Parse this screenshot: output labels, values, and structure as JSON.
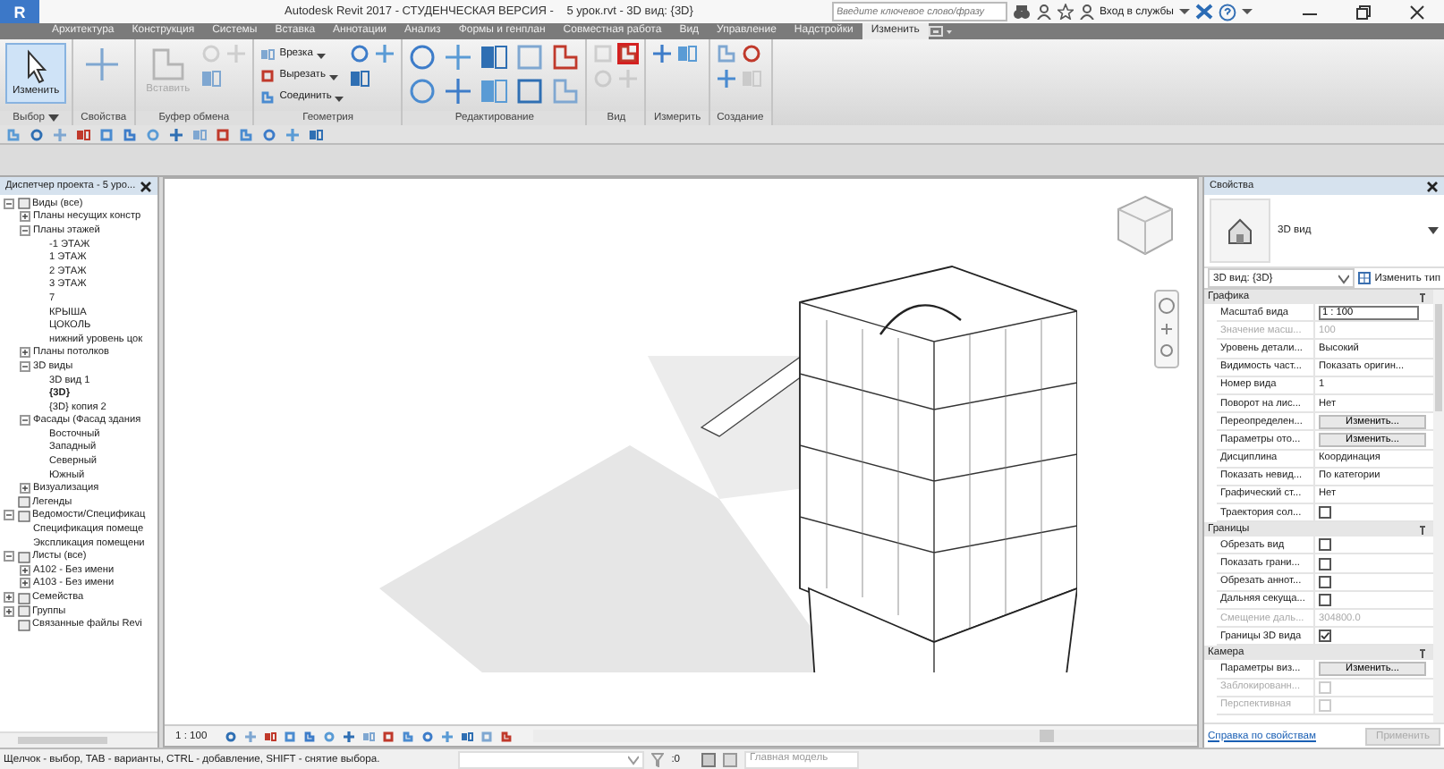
{
  "window": {
    "app_logo": "R",
    "title": "Autodesk Revit 2017 - СТУДЕНЧЕСКАЯ ВЕРСИЯ -    5 урок.rvt - 3D вид: {3D}",
    "search": {
      "placeholder": "Введите ключевое слово/фразу"
    },
    "sign_in": "Вход в службы"
  },
  "ribbon": {
    "tabs": [
      {
        "label": "Архитектура",
        "selected": false
      },
      {
        "label": "Конструкция",
        "selected": false
      },
      {
        "label": "Системы",
        "selected": false
      },
      {
        "label": "Вставка",
        "selected": false
      },
      {
        "label": "Аннотации",
        "selected": false
      },
      {
        "label": "Анализ",
        "selected": false
      },
      {
        "label": "Формы и генплан",
        "selected": false
      },
      {
        "label": "Совместная работа",
        "selected": false
      },
      {
        "label": "Вид",
        "selected": false
      },
      {
        "label": "Управление",
        "selected": false
      },
      {
        "label": "Надстройки",
        "selected": false
      },
      {
        "label": "Изменить",
        "selected": true
      }
    ],
    "panels": [
      {
        "label": "Выбор",
        "dropdown": true,
        "tools": [
          {
            "kind": "large",
            "label": "Изменить",
            "selected": true,
            "disabled": false,
            "highlighted": false
          }
        ]
      },
      {
        "label": "Свойства",
        "dropdown": false,
        "tools": [
          {
            "kind": "large",
            "selected": false,
            "disabled": false,
            "highlighted": false
          }
        ]
      },
      {
        "label": "Буфер обмена",
        "dropdown": false,
        "tools": [
          {
            "kind": "large",
            "label": "Вставить",
            "selected": false,
            "disabled": true,
            "highlighted": false
          },
          {
            "kind": "icon",
            "selected": false,
            "disabled": true,
            "highlighted": false
          },
          {
            "kind": "icon",
            "selected": false,
            "disabled": true,
            "highlighted": false
          },
          {
            "kind": "icon",
            "selected": false,
            "disabled": false,
            "highlighted": false
          }
        ]
      },
      {
        "label": "Геометрия",
        "dropdown": false,
        "tools": [
          {
            "kind": "small",
            "label": "Врезка",
            "selected": false,
            "disabled": false,
            "highlighted": false
          },
          {
            "kind": "small",
            "label": "Вырезать",
            "selected": false,
            "disabled": false,
            "highlighted": false
          },
          {
            "kind": "small",
            "label": "Соединить",
            "selected": false,
            "disabled": false,
            "highlighted": false
          },
          {
            "kind": "icon",
            "selected": false,
            "disabled": false,
            "highlighted": false
          },
          {
            "kind": "icon",
            "selected": false,
            "disabled": false,
            "highlighted": false
          },
          {
            "kind": "icon",
            "selected": false,
            "disabled": false,
            "highlighted": false
          }
        ]
      },
      {
        "label": "Редактирование",
        "dropdown": false,
        "tools": [
          {
            "kind": "icon",
            "selected": false,
            "disabled": false,
            "highlighted": false
          },
          {
            "kind": "icon",
            "selected": false,
            "disabled": false,
            "highlighted": false
          },
          {
            "kind": "icon",
            "selected": false,
            "disabled": false,
            "highlighted": false
          },
          {
            "kind": "icon",
            "selected": false,
            "disabled": false,
            "highlighted": false
          },
          {
            "kind": "icon",
            "selected": false,
            "disabled": false,
            "highlighted": false
          },
          {
            "kind": "icon",
            "selected": false,
            "disabled": false,
            "highlighted": false
          },
          {
            "kind": "icon",
            "selected": false,
            "disabled": false,
            "highlighted": false
          },
          {
            "kind": "icon",
            "selected": false,
            "disabled": false,
            "highlighted": false
          },
          {
            "kind": "icon",
            "selected": false,
            "disabled": false,
            "highlighted": false
          },
          {
            "kind": "icon",
            "selected": false,
            "disabled": false,
            "highlighted": false
          }
        ]
      },
      {
        "label": "Вид",
        "dropdown": false,
        "tools": [
          {
            "kind": "icon",
            "selected": false,
            "disabled": true,
            "highlighted": false
          },
          {
            "kind": "icon",
            "selected": false,
            "disabled": false,
            "highlighted": true
          },
          {
            "kind": "icon",
            "selected": false,
            "disabled": true,
            "highlighted": false
          },
          {
            "kind": "icon",
            "selected": false,
            "disabled": true,
            "highlighted": false
          }
        ]
      },
      {
        "label": "Измерить",
        "dropdown": false,
        "tools": [
          {
            "kind": "icon",
            "selected": false,
            "disabled": false,
            "highlighted": false
          },
          {
            "kind": "icon",
            "selected": false,
            "disabled": false,
            "highlighted": false
          }
        ]
      },
      {
        "label": "Создание",
        "dropdown": false,
        "tools": [
          {
            "kind": "icon",
            "selected": false,
            "disabled": false,
            "highlighted": false
          },
          {
            "kind": "icon",
            "selected": false,
            "disabled": false,
            "highlighted": false
          },
          {
            "kind": "icon",
            "selected": false,
            "disabled": false,
            "highlighted": false
          },
          {
            "kind": "icon",
            "selected": false,
            "disabled": true,
            "highlighted": false
          }
        ]
      }
    ]
  },
  "project_browser": {
    "title": "Диспетчер проекта - 5 уро...",
    "tree": [
      {
        "label": "Виды (все)",
        "expanded": true,
        "selected": false,
        "children": [
          {
            "label": "Планы несущих констр",
            "expanded": false,
            "selected": false
          },
          {
            "label": "Планы этажей",
            "expanded": true,
            "selected": false,
            "children": [
              {
                "label": "-1 ЭТАЖ",
                "selected": false
              },
              {
                "label": "1 ЭТАЖ",
                "selected": false
              },
              {
                "label": "2 ЭТАЖ",
                "selected": false
              },
              {
                "label": "3 ЭТАЖ",
                "selected": false
              },
              {
                "label": "7",
                "selected": false
              },
              {
                "label": "КРЫША",
                "selected": false
              },
              {
                "label": "ЦОКОЛЬ",
                "selected": false
              },
              {
                "label": "нижний уровень цок",
                "selected": false
              }
            ]
          },
          {
            "label": "Планы потолков",
            "expanded": false,
            "selected": false
          },
          {
            "label": "3D виды",
            "expanded": true,
            "selected": false,
            "children": [
              {
                "label": "3D вид 1",
                "selected": false
              },
              {
                "label": "{3D}",
                "selected": true
              },
              {
                "label": "{3D} копия 2",
                "selected": false
              }
            ]
          },
          {
            "label": "Фасады (Фасад здания",
            "expanded": true,
            "selected": false,
            "children": [
              {
                "label": "Восточный",
                "selected": false
              },
              {
                "label": "Западный",
                "selected": false
              },
              {
                "label": "Северный",
                "selected": false
              },
              {
                "label": "Южный",
                "selected": false
              }
            ]
          },
          {
            "label": "Визуализация",
            "expanded": false,
            "selected": false
          }
        ]
      },
      {
        "label": "Легенды",
        "selected": false
      },
      {
        "label": "Ведомости/Спецификац",
        "expanded": true,
        "selected": false,
        "children": [
          {
            "label": "Спецификация помеще",
            "selected": false
          },
          {
            "label": "Экспликация помещени",
            "selected": false
          }
        ]
      },
      {
        "label": "Листы (все)",
        "expanded": true,
        "selected": false,
        "children": [
          {
            "label": "A102 - Без имени",
            "expanded": false,
            "selected": false
          },
          {
            "label": "A103 - Без имени",
            "expanded": false,
            "selected": false
          }
        ]
      },
      {
        "label": "Семейства",
        "expanded": false,
        "selected": false
      },
      {
        "label": "Группы",
        "expanded": false,
        "selected": false
      },
      {
        "label": "Связанные файлы Revi",
        "selected": false
      }
    ]
  },
  "view": {
    "scale": "1 : 100"
  },
  "properties": {
    "title": "Свойства",
    "type_name": "3D вид",
    "instance": "3D вид: {3D}",
    "edit_type": "Изменить тип",
    "groups": [
      {
        "name": "Графика",
        "rows": [
          {
            "kind": "input",
            "label": "Масштаб вида",
            "value": "1 : 100",
            "disabled": false
          },
          {
            "kind": "text",
            "label": "Значение масш...",
            "value": "100",
            "disabled": true
          },
          {
            "kind": "text",
            "label": "Уровень детали...",
            "value": "Высокий",
            "disabled": false
          },
          {
            "kind": "text",
            "label": "Видимость част...",
            "value": "Показать оригин...",
            "disabled": false
          },
          {
            "kind": "text",
            "label": "Номер вида",
            "value": "1",
            "disabled": false
          },
          {
            "kind": "text",
            "label": "Поворот на лис...",
            "value": "Нет",
            "disabled": false
          },
          {
            "kind": "button",
            "label": "Переопределен...",
            "value": "Изменить...",
            "disabled": false
          },
          {
            "kind": "button",
            "label": "Параметры ото...",
            "value": "Изменить...",
            "disabled": false
          },
          {
            "kind": "text",
            "label": "Дисциплина",
            "value": "Координация",
            "disabled": false
          },
          {
            "kind": "text",
            "label": "Показать невид...",
            "value": "По категории",
            "disabled": false
          },
          {
            "kind": "text",
            "label": "Графический ст...",
            "value": "Нет",
            "disabled": false
          },
          {
            "kind": "checkbox",
            "label": "Траектория сол...",
            "checked": false,
            "disabled": false
          }
        ]
      },
      {
        "name": "Границы",
        "rows": [
          {
            "kind": "checkbox",
            "label": "Обрезать вид",
            "checked": false,
            "disabled": false
          },
          {
            "kind": "checkbox",
            "label": "Показать грани...",
            "checked": false,
            "disabled": false
          },
          {
            "kind": "checkbox",
            "label": "Обрезать аннот...",
            "checked": false,
            "disabled": false
          },
          {
            "kind": "checkbox",
            "label": "Дальняя секуща...",
            "checked": false,
            "disabled": false
          },
          {
            "kind": "text",
            "label": "Смещение даль...",
            "value": "304800.0",
            "disabled": true
          },
          {
            "kind": "checkbox",
            "label": "Границы 3D вида",
            "checked": true,
            "disabled": false
          }
        ]
      },
      {
        "name": "Камера",
        "rows": [
          {
            "kind": "button",
            "label": "Параметры виз...",
            "value": "Изменить...",
            "disabled": false
          },
          {
            "kind": "checkbox",
            "label": "Заблокированн...",
            "checked": false,
            "disabled": true
          },
          {
            "kind": "checkbox",
            "label": "Перспективная",
            "checked": false,
            "disabled": true
          }
        ]
      }
    ],
    "help_link": "Справка по свойствам",
    "apply": {
      "label": "Применить",
      "disabled": true
    }
  },
  "status_bar": {
    "hint": "Щелчок - выбор, TAB - варианты, CTRL - добавление, SHIFT - снятие выбора.",
    "selection_count": ":0",
    "workset": "Главная модель"
  }
}
